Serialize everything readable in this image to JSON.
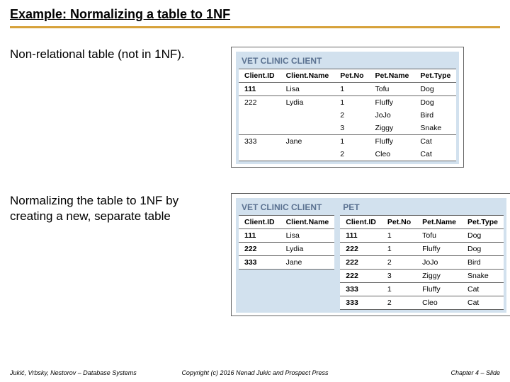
{
  "title": "Example: Normalizing a table to 1NF",
  "caption1": "Non-relational table (not in 1NF).",
  "caption2": "Normalizing the table to 1NF by creating a new, separate table",
  "footer": {
    "left": "Jukić, Vrbsky, Nestorov – Database Systems",
    "center": "Copyright (c) 2016 Nenad Jukic and Prospect Press",
    "right": "Chapter 4 – Slide"
  },
  "chart_data": [
    {
      "type": "table",
      "title": "VET CLINIC CLIENT",
      "columns": [
        "Client.ID",
        "Client.Name",
        "Pet.No",
        "Pet.Name",
        "Pet.Type"
      ],
      "rows": [
        [
          "111",
          "Lisa",
          "1",
          "Tofu",
          "Dog"
        ],
        [
          "222",
          "Lydia",
          "1",
          "Fluffy",
          "Dog"
        ],
        [
          "",
          "",
          "2",
          "JoJo",
          "Bird"
        ],
        [
          "",
          "",
          "3",
          "Ziggy",
          "Snake"
        ],
        [
          "333",
          "Jane",
          "1",
          "Fluffy",
          "Cat"
        ],
        [
          "",
          "",
          "2",
          "Cleo",
          "Cat"
        ]
      ]
    },
    {
      "type": "table",
      "title": "VET CLINIC CLIENT",
      "columns": [
        "Client.ID",
        "Client.Name"
      ],
      "rows": [
        [
          "111",
          "Lisa"
        ],
        [
          "222",
          "Lydia"
        ],
        [
          "333",
          "Jane"
        ]
      ]
    },
    {
      "type": "table",
      "title": "PET",
      "columns": [
        "Client.ID",
        "Pet.No",
        "Pet.Name",
        "Pet.Type"
      ],
      "rows": [
        [
          "111",
          "1",
          "Tofu",
          "Dog"
        ],
        [
          "222",
          "1",
          "Fluffy",
          "Dog"
        ],
        [
          "222",
          "2",
          "JoJo",
          "Bird"
        ],
        [
          "222",
          "3",
          "Ziggy",
          "Snake"
        ],
        [
          "333",
          "1",
          "Fluffy",
          "Cat"
        ],
        [
          "333",
          "2",
          "Cleo",
          "Cat"
        ]
      ]
    }
  ]
}
